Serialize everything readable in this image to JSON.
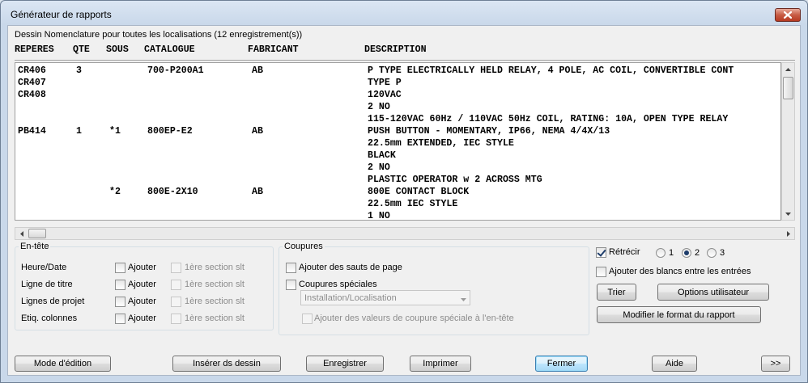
{
  "window": {
    "title": "Générateur de rapports"
  },
  "report": {
    "caption": "Dessin Nomenclature pour toutes les localisations (12 enregistrement(s))",
    "columns": [
      "REPERES",
      "QTE",
      "SOUS",
      "CATALOGUE",
      "FABRICANT",
      "DESCRIPTION"
    ],
    "rows": [
      [
        "CR406",
        "3",
        "",
        "700-P200A1",
        "AB",
        "P TYPE ELECTRICALLY HELD RELAY, 4 POLE, AC COIL, CONVERTIBLE CONT"
      ],
      [
        "CR407",
        "",
        "",
        "",
        "",
        "TYPE P"
      ],
      [
        "CR408",
        "",
        "",
        "",
        "",
        "120VAC"
      ],
      [
        "",
        "",
        "",
        "",
        "",
        "2 NO"
      ],
      [
        "",
        "",
        "",
        "",
        "",
        "115-120VAC 60Hz / 110VAC 50Hz COIL, RATING: 10A, OPEN TYPE RELAY"
      ],
      [
        "PB414",
        "1",
        "*1",
        "800EP-E2",
        "AB",
        "PUSH BUTTON - MOMENTARY, IP66, NEMA 4/4X/13"
      ],
      [
        "",
        "",
        "",
        "",
        "",
        "22.5mm EXTENDED, IEC STYLE"
      ],
      [
        "",
        "",
        "",
        "",
        "",
        "BLACK"
      ],
      [
        "",
        "",
        "",
        "",
        "",
        "2 NO"
      ],
      [
        "",
        "",
        "",
        "",
        "",
        "PLASTIC OPERATOR w 2 ACROSS MTG"
      ],
      [
        "",
        "",
        "*2",
        "800E-2X10",
        "AB",
        "800E CONTACT BLOCK"
      ],
      [
        "",
        "",
        "",
        "",
        "",
        "22.5mm IEC STYLE"
      ],
      [
        "",
        "",
        "",
        "",
        "",
        "1 NO"
      ]
    ]
  },
  "header_group": {
    "legend": "En-tête",
    "rows": [
      {
        "label": "Heure/Date",
        "add": "Ajouter",
        "first": "1ère section slt"
      },
      {
        "label": "Ligne de titre",
        "add": "Ajouter",
        "first": "1ère section slt"
      },
      {
        "label": "Lignes de projet",
        "add": "Ajouter",
        "first": "1ère section slt"
      },
      {
        "label": "Etiq. colonnes",
        "add": "Ajouter",
        "first": "1ère section slt"
      }
    ]
  },
  "breaks_group": {
    "legend": "Coupures",
    "page_breaks": "Ajouter des sauts de page",
    "special_breaks": "Coupures spéciales",
    "select_value": "Installation/Localisation",
    "add_special": "Ajouter des valeurs de coupure spéciale à l'en-tête"
  },
  "options": {
    "shrink": {
      "label": "Rétrécir",
      "checked": true
    },
    "radios": [
      {
        "label": "1",
        "selected": false
      },
      {
        "label": "2",
        "selected": true
      },
      {
        "label": "3",
        "selected": false
      }
    ],
    "blanks": "Ajouter des blancs entre les entrées",
    "sort": "Trier",
    "user_options": "Options utilisateur",
    "format": "Modifier le format du rapport"
  },
  "buttons": {
    "edit_mode": "Mode d'édition",
    "insert": "Insérer ds dessin",
    "save": "Enregistrer",
    "print": "Imprimer",
    "close": "Fermer",
    "help": "Aide",
    "more": ">>"
  },
  "colors": {
    "titlebar": "#c9d8ea",
    "close_button": "#c75c45",
    "default_button": "#3c7fb1"
  }
}
